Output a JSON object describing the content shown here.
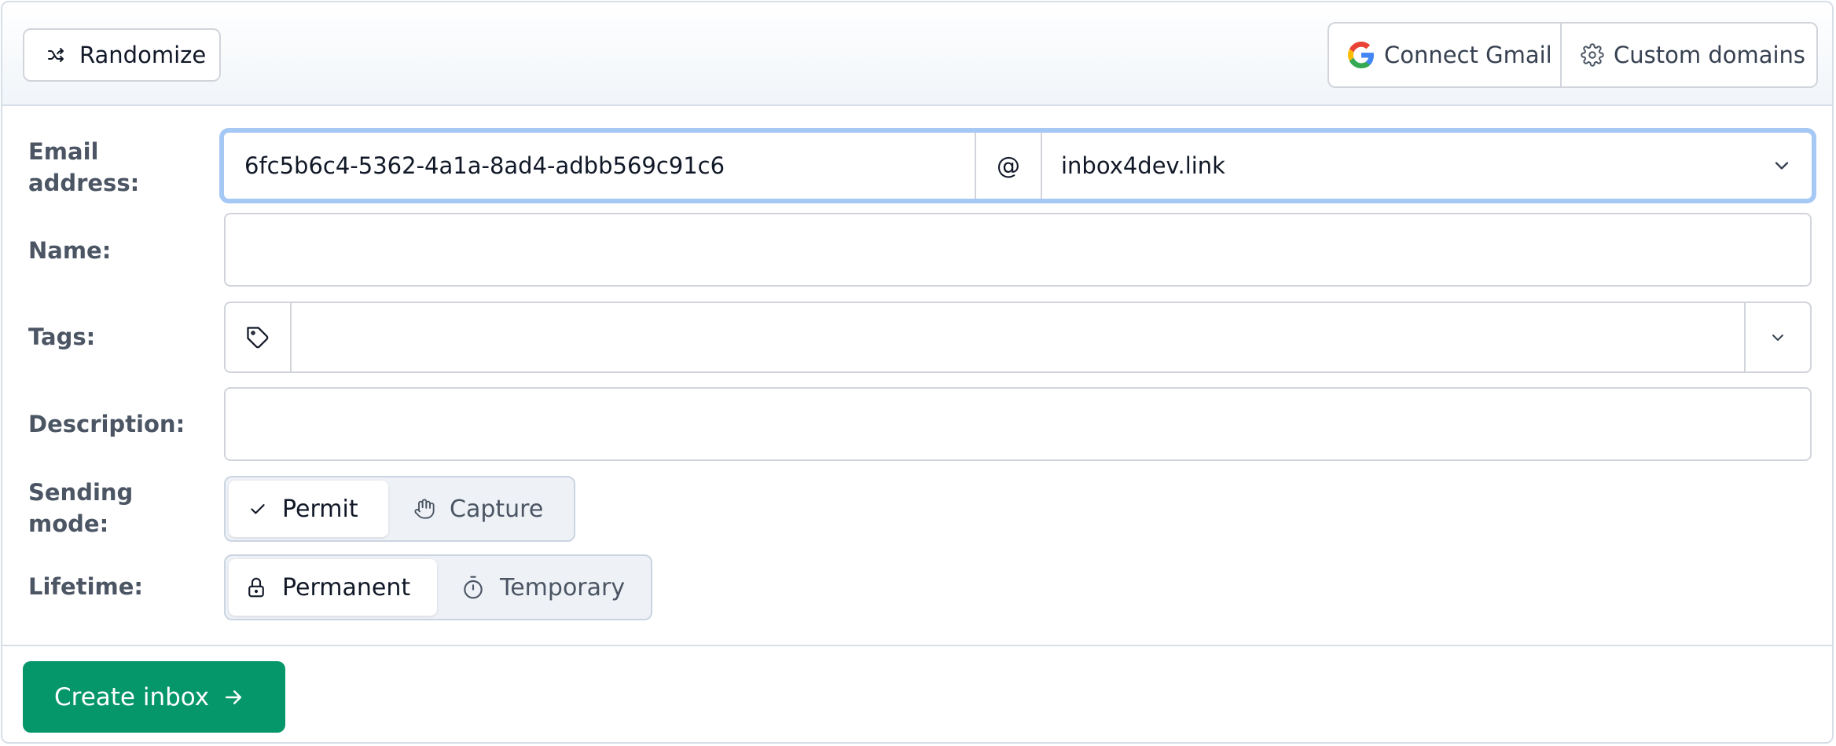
{
  "header": {
    "randomize_label": "Randomize",
    "connect_gmail_label": "Connect Gmail",
    "custom_domains_label": "Custom domains"
  },
  "form": {
    "email_label": "Email address:",
    "email_local": "6fc5b6c4-5362-4a1a-8ad4-adbb569c91c6",
    "email_at": "@",
    "email_domain": "inbox4dev.link",
    "name_label": "Name:",
    "name_value": "",
    "tags_label": "Tags:",
    "tags_value": "",
    "description_label": "Description:",
    "description_value": "",
    "sending_mode_label": "Sending mode:",
    "sending_mode_options": [
      "Permit",
      "Capture"
    ],
    "sending_mode_selected": "Permit",
    "lifetime_label": "Lifetime:",
    "lifetime_options": [
      "Permanent",
      "Temporary"
    ],
    "lifetime_selected": "Permanent"
  },
  "footer": {
    "create_label": "Create inbox"
  },
  "icons": {
    "randomize": "shuffle-icon",
    "gmail": "google-icon",
    "domains": "gear-icon",
    "tags": "tag-icon",
    "dropdown": "chevron-down-icon",
    "permit": "check-icon",
    "capture": "hand-icon",
    "permanent": "lock-icon",
    "temporary": "timer-icon",
    "create": "arrow-right-icon"
  },
  "colors": {
    "primary": "#059669",
    "focus_ring": "#a5c8f5",
    "label": "#4b5563",
    "border": "#d1d5db"
  }
}
